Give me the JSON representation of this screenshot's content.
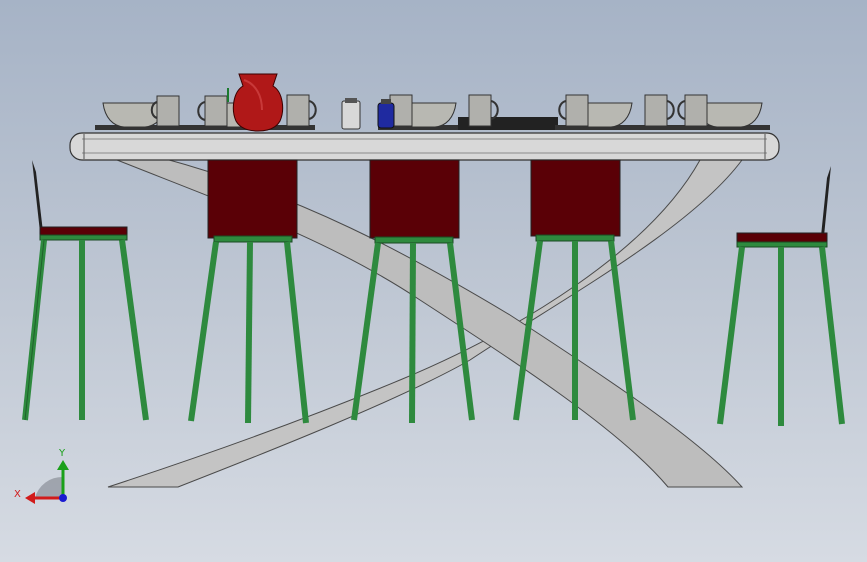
{
  "viewport": {
    "background_top": "#a6b3c6",
    "background_bottom": "#d6dbe3"
  },
  "model": {
    "table_color": "#c9c9c9",
    "stool_seat_color": "#5a0006",
    "stool_leg_color": "#2e8a3e",
    "pitcher_color": "#b01818",
    "tableware_color": "#b4b4b0"
  },
  "triad": {
    "x_label": "X",
    "y_label": "Y",
    "x_color": "#d11a1a",
    "y_color": "#1aa01a",
    "z_color": "#1a1ad1"
  }
}
